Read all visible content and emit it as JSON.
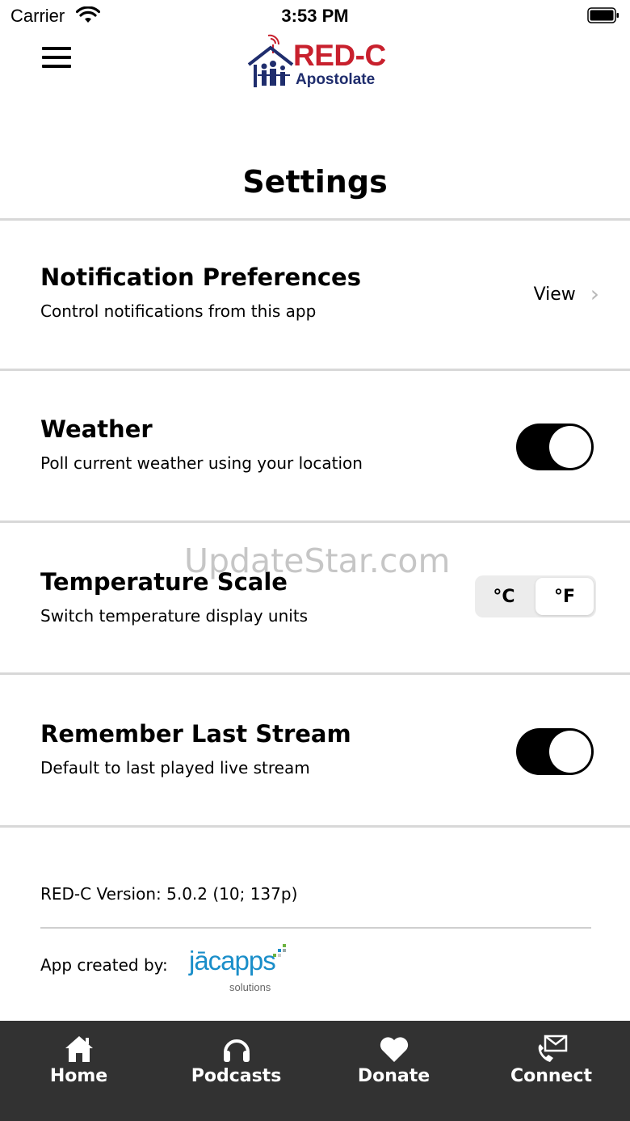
{
  "status_bar": {
    "carrier": "Carrier",
    "time": "3:53 PM"
  },
  "header": {
    "logo_title": "RED-C",
    "logo_subtitle": "Apostolate",
    "brand_color": "#c8202d",
    "brand_secondary": "#1f2d6d"
  },
  "page": {
    "title": "Settings"
  },
  "settings": {
    "notifications": {
      "title": "Notification Preferences",
      "subtitle": "Control notifications from this app",
      "action": "View"
    },
    "weather": {
      "title": "Weather",
      "subtitle": "Poll current weather using your location",
      "enabled": true
    },
    "temperature": {
      "title": "Temperature Scale",
      "subtitle": "Switch temperature display units",
      "options": [
        "°C",
        "°F"
      ],
      "selected": "°F"
    },
    "remember_stream": {
      "title": "Remember Last Stream",
      "subtitle": "Default to last played live stream",
      "enabled": true
    }
  },
  "watermark": "UpdateStar.com",
  "footer": {
    "version": "RED-C Version: 5.0.2 (10; 137p)",
    "created_by": "App created by:",
    "maker_logo": "jācapps",
    "maker_sub": "solutions"
  },
  "tabbar": {
    "items": [
      {
        "label": "Home",
        "icon": "home-icon"
      },
      {
        "label": "Podcasts",
        "icon": "headphones-icon"
      },
      {
        "label": "Donate",
        "icon": "heart-icon"
      },
      {
        "label": "Connect",
        "icon": "mail-phone-icon"
      }
    ]
  }
}
